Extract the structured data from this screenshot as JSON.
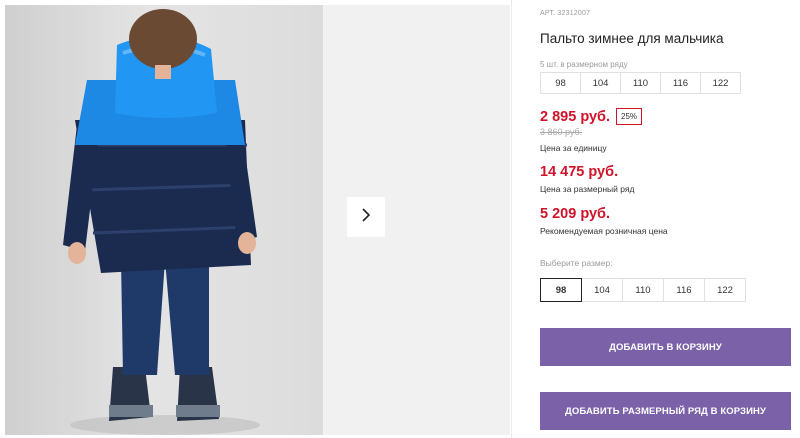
{
  "gallery": {
    "next_icon": "chevron-right-icon"
  },
  "product": {
    "article": "АРТ. 32312007",
    "title": "Пальто зимнее для мальчика",
    "row_caption": "5 шт. в размерном ряду",
    "row_sizes": [
      "98",
      "104",
      "110",
      "116",
      "122"
    ],
    "price": "2 895 руб.",
    "discount": "25%",
    "old_price": "3 860 руб.",
    "price_caption": "Цена за единицу",
    "row_price": "14 475 руб.",
    "row_price_caption": "Цена за размерный ряд",
    "retail_price": "5 209 руб.",
    "retail_price_caption": "Рекомендуемая розничная цена",
    "choose_size_label": "Выберите размер:",
    "sizes": [
      "98",
      "104",
      "110",
      "116",
      "122"
    ],
    "selected_size": "98"
  },
  "actions": {
    "add_to_cart": "Добавить в корзину",
    "add_row_to_cart": "Добавить размерный ряд в корзину"
  },
  "colors": {
    "accent": "#7a61a8",
    "price_red": "#d1132a"
  }
}
